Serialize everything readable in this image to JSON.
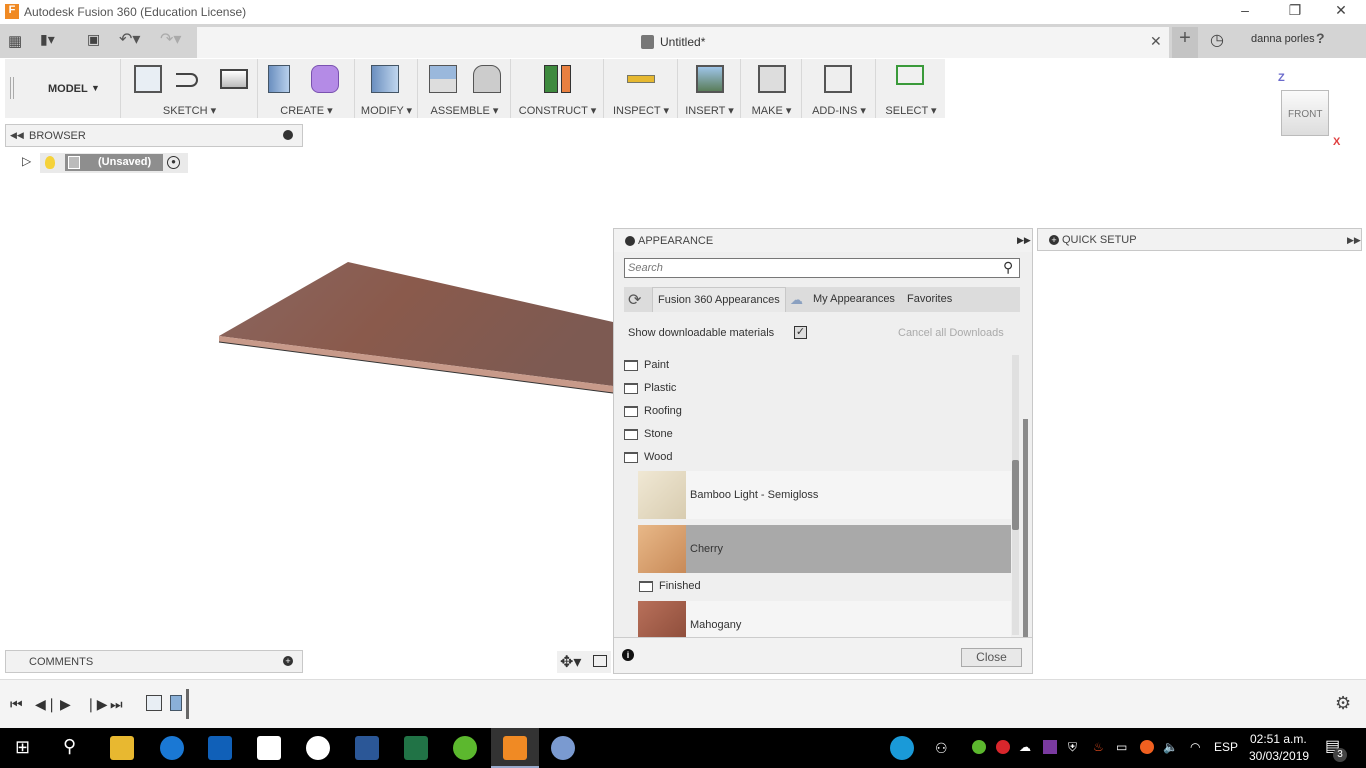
{
  "window": {
    "title": "Autodesk Fusion 360 (Education License)"
  },
  "tabbar": {
    "doc_title": "Untitled*",
    "user": "danna porles",
    "help": "?"
  },
  "toolbar": {
    "workspace": "MODEL",
    "groups": [
      "SKETCH",
      "CREATE",
      "MODIFY",
      "ASSEMBLE",
      "CONSTRUCT",
      "INSPECT",
      "INSERT",
      "MAKE",
      "ADD-INS",
      "SELECT"
    ]
  },
  "browser": {
    "title": "BROWSER",
    "root": "(Unsaved)"
  },
  "comments": {
    "title": "COMMENTS"
  },
  "viewcube": {
    "face": "FRONT",
    "axes": [
      "Z",
      "X"
    ]
  },
  "appearance": {
    "title": "APPEARANCE",
    "search_placeholder": "Search",
    "tabs": [
      "Fusion 360 Appearances",
      "My Appearances",
      "Favorites"
    ],
    "active_tab": "Fusion 360 Appearances",
    "show_downloadable_label": "Show downloadable materials",
    "show_downloadable": true,
    "cancel_downloads": "Cancel all Downloads",
    "folders": [
      "Paint",
      "Plastic",
      "Roofing",
      "Stone",
      "Wood"
    ],
    "wood_items": [
      {
        "name": "Bamboo Light - Semigloss",
        "color": "#e8dcc4"
      },
      {
        "name": "Cherry",
        "color": "#d9a472",
        "selected": true
      }
    ],
    "subfolder": "Finished",
    "finished_items": [
      {
        "name": "Mahogany",
        "color": "#a8604a"
      }
    ],
    "close": "Close"
  },
  "quick_setup": {
    "title": "QUICK SETUP"
  },
  "taskbar": {
    "language": "ESP",
    "time": "02:51 a.m.",
    "date": "30/03/2019",
    "notifications": "3"
  },
  "colors": {
    "selected_row": "#a9a9a9",
    "taskbar": "#000000",
    "board": "#8a5d52"
  }
}
